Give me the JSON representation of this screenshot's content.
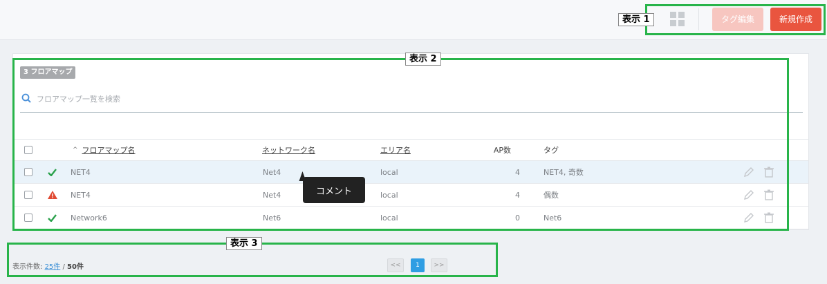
{
  "toolbar": {
    "grid_icon": "grid-view-icon",
    "tag_edit_label": "タグ編集",
    "new_label": "新規作成"
  },
  "panel": {
    "count_badge": "3 フロアマップ",
    "search_placeholder": "フロアマップ一覧を検索",
    "columns": {
      "name": "フロアマップ名",
      "network": "ネットワーク名",
      "area": "エリア名",
      "ap_count": "AP数",
      "tag": "タグ"
    },
    "rows": [
      {
        "status": "ok",
        "name": "NET4",
        "network": "Net4",
        "area": "local",
        "ap": "4",
        "tag": "NET4, 奇数"
      },
      {
        "status": "warning",
        "name": "NET4",
        "network": "Net4",
        "area": "local",
        "ap": "4",
        "tag": "偶数"
      },
      {
        "status": "ok",
        "name": "Network6",
        "network": "Net6",
        "area": "local",
        "ap": "0",
        "tag": "Net6"
      }
    ]
  },
  "tooltip": "コメント",
  "footer": {
    "per_page_label": "表示件数:",
    "per_page_value": "25件",
    "separator": "/",
    "total": "50件",
    "prev": "<<",
    "current_page": "1",
    "next": ">>"
  },
  "annotations": {
    "label1": "表示 1",
    "label2": "表示 2",
    "label3": "表示 3"
  },
  "colors": {
    "accent": "#e9553f",
    "annotation": "#28b44a",
    "link": "#3a8fd6"
  }
}
